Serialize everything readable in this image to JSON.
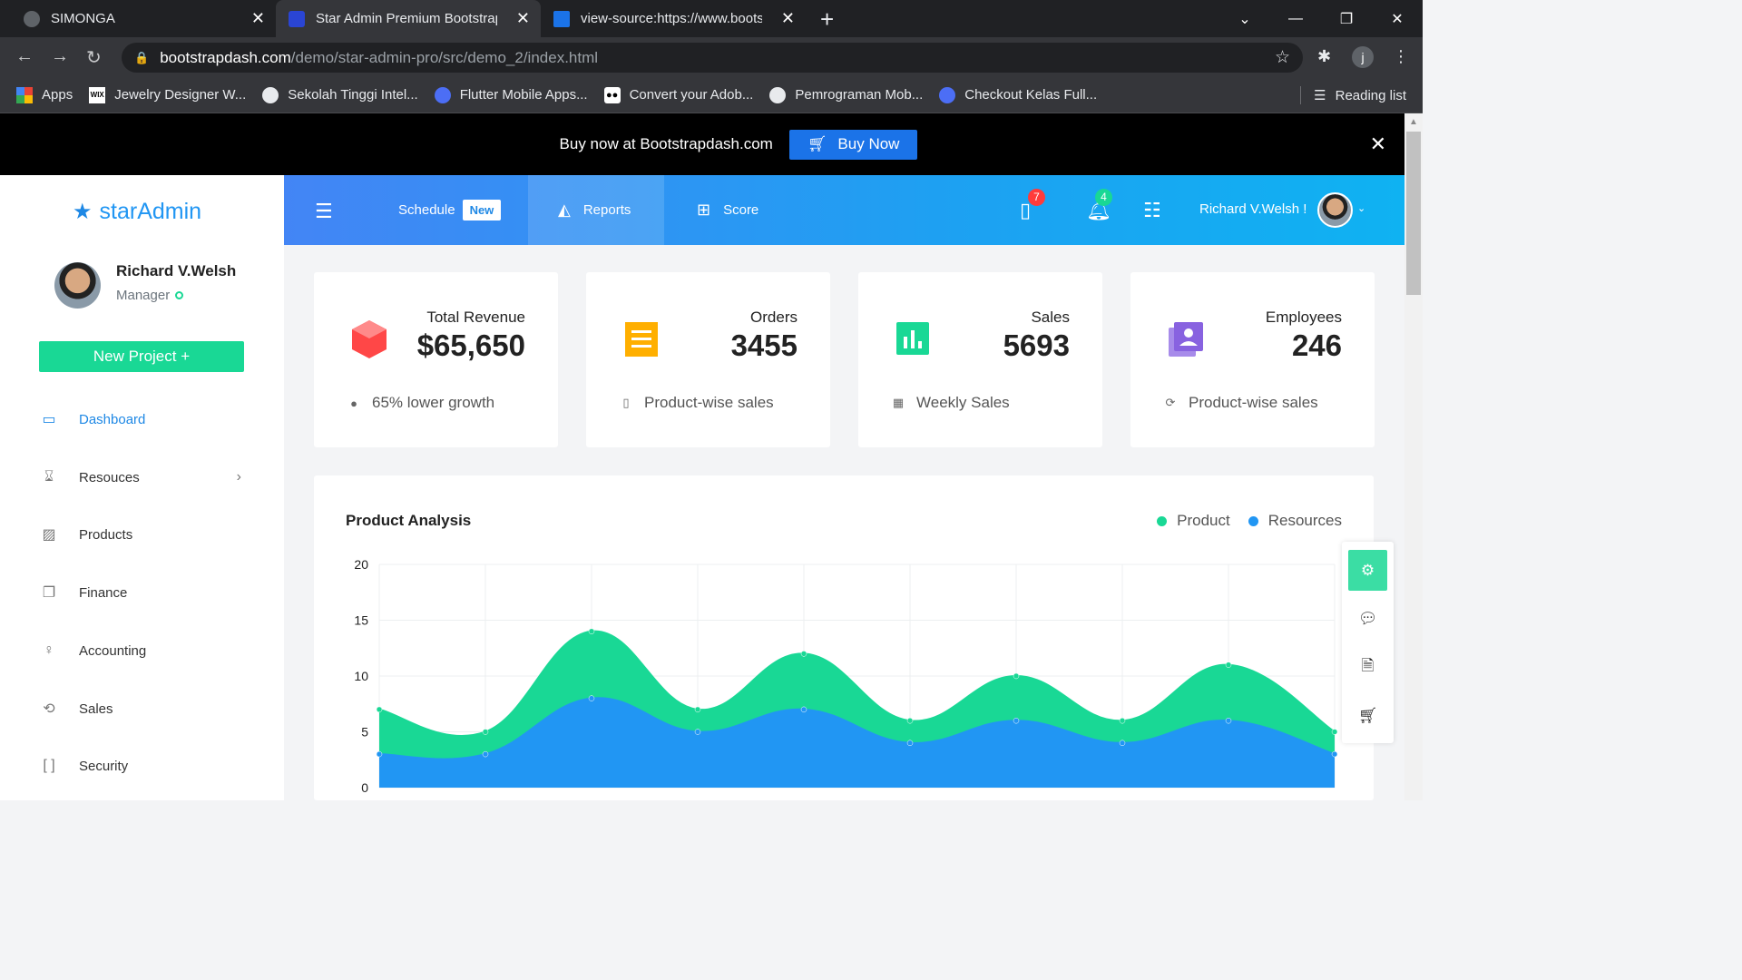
{
  "browser": {
    "tabs": [
      {
        "title": "SIMONGA",
        "active": false
      },
      {
        "title": "Star Admin Premium Bootstrap A",
        "active": true
      },
      {
        "title": "view-source:https://www.bootstr",
        "active": false
      }
    ],
    "url_domain": "bootstrapdash.com",
    "url_path": "/demo/star-admin-pro/src/demo_2/index.html",
    "profile_initial": "j",
    "bookmarks": [
      {
        "label": "Apps",
        "icon": "apps-grid-icon"
      },
      {
        "label": "Jewelry Designer W...",
        "icon": "wix-icon"
      },
      {
        "label": "Sekolah Tinggi Intel...",
        "icon": "globe-icon"
      },
      {
        "label": "Flutter Mobile Apps...",
        "icon": "course-icon"
      },
      {
        "label": "Convert your Adob...",
        "icon": "medium-icon"
      },
      {
        "label": "Pemrograman Mob...",
        "icon": "github-icon"
      },
      {
        "label": "Checkout Kelas Full...",
        "icon": "course-icon"
      }
    ],
    "reading_list": "Reading list"
  },
  "promo": {
    "text": "Buy now at Bootstrapdash.com",
    "button": "Buy Now"
  },
  "sidebar": {
    "brand_part1": "star",
    "brand_part2": "Admin",
    "user_name": "Richard V.Welsh",
    "user_role": "Manager",
    "new_project": "New Project +",
    "items": [
      {
        "label": "Dashboard",
        "icon": "monitor-icon",
        "active": true
      },
      {
        "label": "Resouces",
        "icon": "hourglass-icon",
        "active": false
      },
      {
        "label": "Products",
        "icon": "stripes-icon",
        "active": false
      },
      {
        "label": "Finance",
        "icon": "copy-icon",
        "active": false
      },
      {
        "label": "Accounting",
        "icon": "lightbulb-icon",
        "active": false
      },
      {
        "label": "Sales",
        "icon": "history-icon",
        "active": false
      },
      {
        "label": "Security",
        "icon": "brackets-icon",
        "active": false
      }
    ]
  },
  "topnav": {
    "schedule": "Schedule",
    "schedule_badge": "New",
    "reports": "Reports",
    "score": "Score",
    "tasks_count": "7",
    "notifications_count": "4",
    "user": "Richard V.Welsh !"
  },
  "cards": [
    {
      "label": "Total Revenue",
      "value": "$65,650",
      "footer": "65% lower growth",
      "icon": "cube-icon",
      "color": "#ff4747"
    },
    {
      "label": "Orders",
      "value": "3455",
      "footer": "Product-wise sales",
      "icon": "receipt-icon",
      "color": "#ffaf00"
    },
    {
      "label": "Sales",
      "value": "5693",
      "footer": "Weekly Sales",
      "icon": "poll-icon",
      "color": "#19d895"
    },
    {
      "label": "Employees",
      "value": "246",
      "footer": "Product-wise sales",
      "icon": "contacts-icon",
      "color": "#8862e0"
    }
  ],
  "chart": {
    "title": "Product Analysis",
    "legend": [
      "Product",
      "Resources"
    ]
  },
  "chart_data": {
    "type": "area",
    "title": "Product Analysis",
    "ylim": [
      0,
      20
    ],
    "yticks": [
      0,
      5,
      10,
      15,
      20
    ],
    "series": [
      {
        "name": "Product",
        "color": "#19d895",
        "values": [
          7,
          5,
          14,
          7,
          12,
          6,
          10,
          6,
          11,
          5
        ]
      },
      {
        "name": "Resources",
        "color": "#2196f3",
        "values": [
          3,
          3,
          8,
          5,
          7,
          4,
          6,
          4,
          6,
          3
        ]
      }
    ],
    "grid": true,
    "legend_position": "top-right"
  }
}
